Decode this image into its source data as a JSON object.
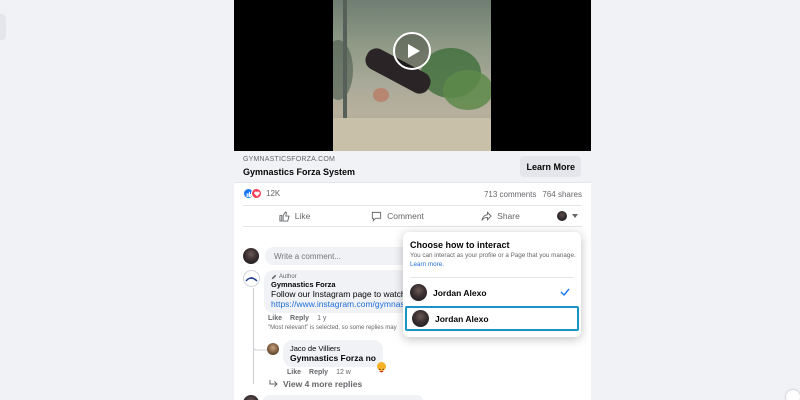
{
  "link_preview": {
    "domain": "GYMNASTICSFORZA.COM",
    "title": "Gymnastics Forza System",
    "cta_label": "Learn More"
  },
  "stats": {
    "reaction_count": "12K",
    "comments": "713 comments",
    "shares": "764 shares"
  },
  "actions": {
    "like": "Like",
    "comment": "Comment",
    "share": "Share"
  },
  "composer": {
    "placeholder": "Write a comment..."
  },
  "comments": [
    {
      "badge": "Author",
      "name": "Gymnastics Forza",
      "text": "Follow our Instagram page to watch m",
      "link": "https://www.instagram.com/gymnasti",
      "like": "Like",
      "reply": "Reply",
      "time": "1 y",
      "note": "\"Most relevant\" is selected, so some replies may"
    },
    {
      "name": "Jaco de Villiers",
      "text": "Gymnastics Forza no",
      "like": "Like",
      "reply": "Reply",
      "time": "12 w"
    }
  ],
  "view_more_replies": "View 4 more replies",
  "interact_popup": {
    "title": "Choose how to interact",
    "description": "You can interact as your profile or a Page that you manage.",
    "learn_more": "Learn more.",
    "profiles": [
      {
        "name": "Jordan Alexo",
        "checked": true
      },
      {
        "name": "Jordan Alexo",
        "checked": false
      }
    ]
  },
  "colors": {
    "accent_blue": "#1877f2",
    "link_blue": "#216fdb",
    "focus_outline": "#1a93c7",
    "page_bg": "#f0f2f5"
  }
}
